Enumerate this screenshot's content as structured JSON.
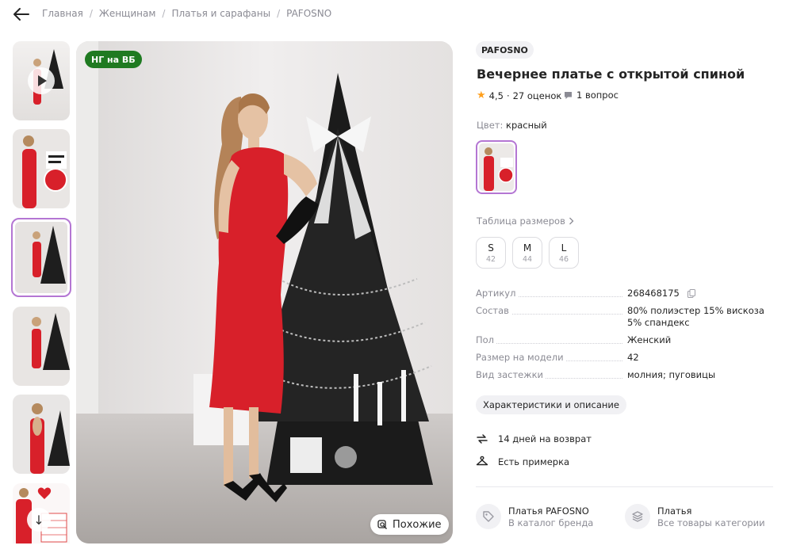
{
  "breadcrumb": [
    "Главная",
    "Женщинам",
    "Платья и сарафаны",
    "PAFOSNO"
  ],
  "badge": "НГ на ВБ",
  "similar_label": "Похожие",
  "brand": "PAFOSNO",
  "title": "Вечернее платье с открытой спиной",
  "rating": {
    "value": "4,5",
    "count": "27 оценок"
  },
  "questions": "1 вопрос",
  "color": {
    "label": "Цвет:",
    "value": "красный"
  },
  "size_table_label": "Таблица размеров",
  "sizes": [
    {
      "label": "S",
      "ru": "42"
    },
    {
      "label": "M",
      "ru": "44"
    },
    {
      "label": "L",
      "ru": "46"
    }
  ],
  "specs": [
    {
      "key": "Артикул",
      "value": "268468175"
    },
    {
      "key": "Состав",
      "value": "80% полиэстер 15% вискоза 5% спандекс"
    },
    {
      "key": "Пол",
      "value": "Женский"
    },
    {
      "key": "Размер на модели",
      "value": "42"
    },
    {
      "key": "Вид застежки",
      "value": "молния; пуговицы"
    }
  ],
  "characteristics_button": "Характеристики и описание",
  "features": [
    "14 дней на возврат",
    "Есть примерка"
  ],
  "brand_link": {
    "title": "Платья PAFOSNO",
    "subtitle": "В каталог бренда"
  },
  "category_link": {
    "title": "Платья",
    "subtitle": "Все товары категории"
  },
  "colors": {
    "accent": "#b476d3",
    "badge": "#1f7a21",
    "star": "#ff9f1c",
    "dress": "#d8202a"
  }
}
